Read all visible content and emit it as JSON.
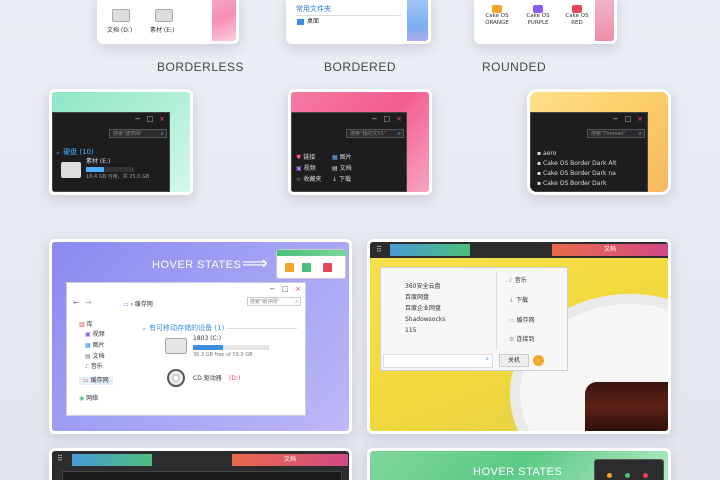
{
  "top_row": {
    "left": {
      "drive1": "文档 (D:)",
      "drive2": "素材 (E:)"
    },
    "middle": {
      "folder_link": "常用文件夹",
      "item": "桌面"
    },
    "right": {
      "badges": [
        {
          "line1": "Cake OS",
          "line2": "ORANGE",
          "color": "#f4a52a"
        },
        {
          "line1": "Cake OS",
          "line2": "PURPLE",
          "color": "#8a5cf6"
        },
        {
          "line1": "Cake OS",
          "line2": "RED",
          "color": "#e8455a"
        }
      ]
    }
  },
  "labels": {
    "borderless": "BORDERLESS",
    "bordered": "BORDERED",
    "rounded": "ROUNDED"
  },
  "row2": {
    "win1": {
      "search": "搜索\"建筑网\"",
      "section": "硬盘 (10)",
      "drive": "素材 (E:)",
      "free": "16.4 GB 可用，共 25.0 GB"
    },
    "win2": {
      "search": "搜索\"我的文55\"",
      "left_items": [
        "链接",
        "视频",
        "收藏夹"
      ],
      "right_items": [
        "图片",
        "文档",
        "下载"
      ]
    },
    "win3": {
      "search": "搜索\"Themes\"",
      "items": [
        "aero",
        "Cake OS Border Dark Alt",
        "Cake OS Border Dark na",
        "Cake OS Border Dark"
      ]
    }
  },
  "hover_card": {
    "title": "HOVER STATES",
    "search": "搜索\"缓存网\"",
    "path": "缓存网",
    "nav": [
      "库",
      "视频",
      "图片",
      "文档",
      "音乐",
      "缓存网",
      "网络"
    ],
    "section": "有可移动存储的设备 (1)",
    "drive1": {
      "name": "1803 (C:)",
      "free": "36.3 GB free of 59.3 GB",
      "fill": 0.39
    },
    "drive2": {
      "name": "CD 驱动器",
      "letter": "(D:)"
    }
  },
  "tray_card": {
    "title": "文档",
    "list": [
      "360安全云盘",
      "百度网盘",
      "百度企业网盘",
      "Shadowsocks",
      "115"
    ],
    "actions": [
      "音乐",
      "下载",
      "缓存网",
      "连接到"
    ],
    "close_button": "关机"
  },
  "bottom_row": {
    "left_title": "文档",
    "right_title": "HOVER STATES"
  }
}
